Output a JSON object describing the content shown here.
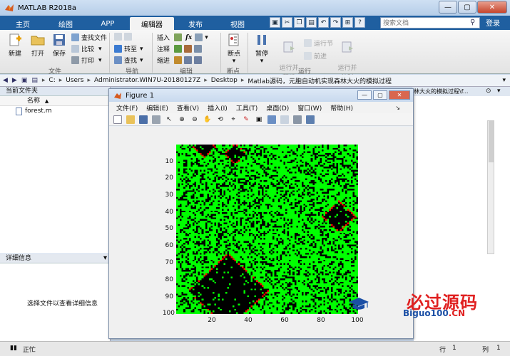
{
  "window": {
    "title": "MATLAB R2018a",
    "min": "—",
    "max": "▢",
    "close": "✕"
  },
  "tabs": [
    {
      "label": "主页"
    },
    {
      "label": "绘图"
    },
    {
      "label": "APP"
    },
    {
      "label": "编辑器"
    },
    {
      "label": "发布"
    },
    {
      "label": "视图"
    }
  ],
  "search": {
    "placeholder": "搜索文档"
  },
  "login": "登录",
  "ribbon": {
    "new": "新建",
    "open": "打开",
    "save": "保存",
    "find_files": "查找文件",
    "compare": "比较",
    "print": "打印",
    "file_group": "文件",
    "goto": "转至",
    "find": "查找",
    "nav_group": "导航",
    "insert": "插入",
    "comment": "注释",
    "indent": "缩进",
    "edit_group": "编辑",
    "breakpoints": "断点",
    "bp_group": "断点",
    "pause": "暂停",
    "run_advance": "运行并\n前进",
    "run_section": "运行节",
    "advance": "前进",
    "run_time": "运行并\n计时",
    "run_group": "运行"
  },
  "address": {
    "crumbs": [
      "C:",
      "Users",
      "Administrator.WIN7U-20180127Z",
      "Desktop",
      "Matlab源码，元胞自动机实现森林大火的模拟过程"
    ]
  },
  "current_folder": {
    "title": "当前文件夹",
    "col_name": "名称",
    "sort": "▲",
    "files": [
      "forest.m"
    ]
  },
  "details": {
    "title": "详细信息",
    "message": "选择文件以查看详细信息"
  },
  "right_panel": {
    "title": "林大火的模拟过程\\f..."
  },
  "figure": {
    "title": "Figure 1",
    "menu": [
      "文件(F)",
      "编辑(E)",
      "查看(V)",
      "插入(I)",
      "工具(T)",
      "桌面(D)",
      "窗口(W)",
      "帮助(H)"
    ],
    "yticks": [
      "10",
      "20",
      "30",
      "40",
      "50",
      "60",
      "70",
      "80",
      "90",
      "100"
    ],
    "xticks": [
      "20",
      "40",
      "60",
      "80",
      "100"
    ]
  },
  "statusbar": {
    "status": "正忙",
    "row_label": "行",
    "row": "1",
    "col_label": "列",
    "col": "1"
  },
  "watermark": {
    "line1": "必过源码",
    "line2a": "Biguo100",
    "line2b": ".CN"
  },
  "colors": {
    "tree": "#00ff00",
    "empty": "#000000",
    "burning": "#ff0000",
    "ribbon_tab": "#1f5fa0"
  }
}
